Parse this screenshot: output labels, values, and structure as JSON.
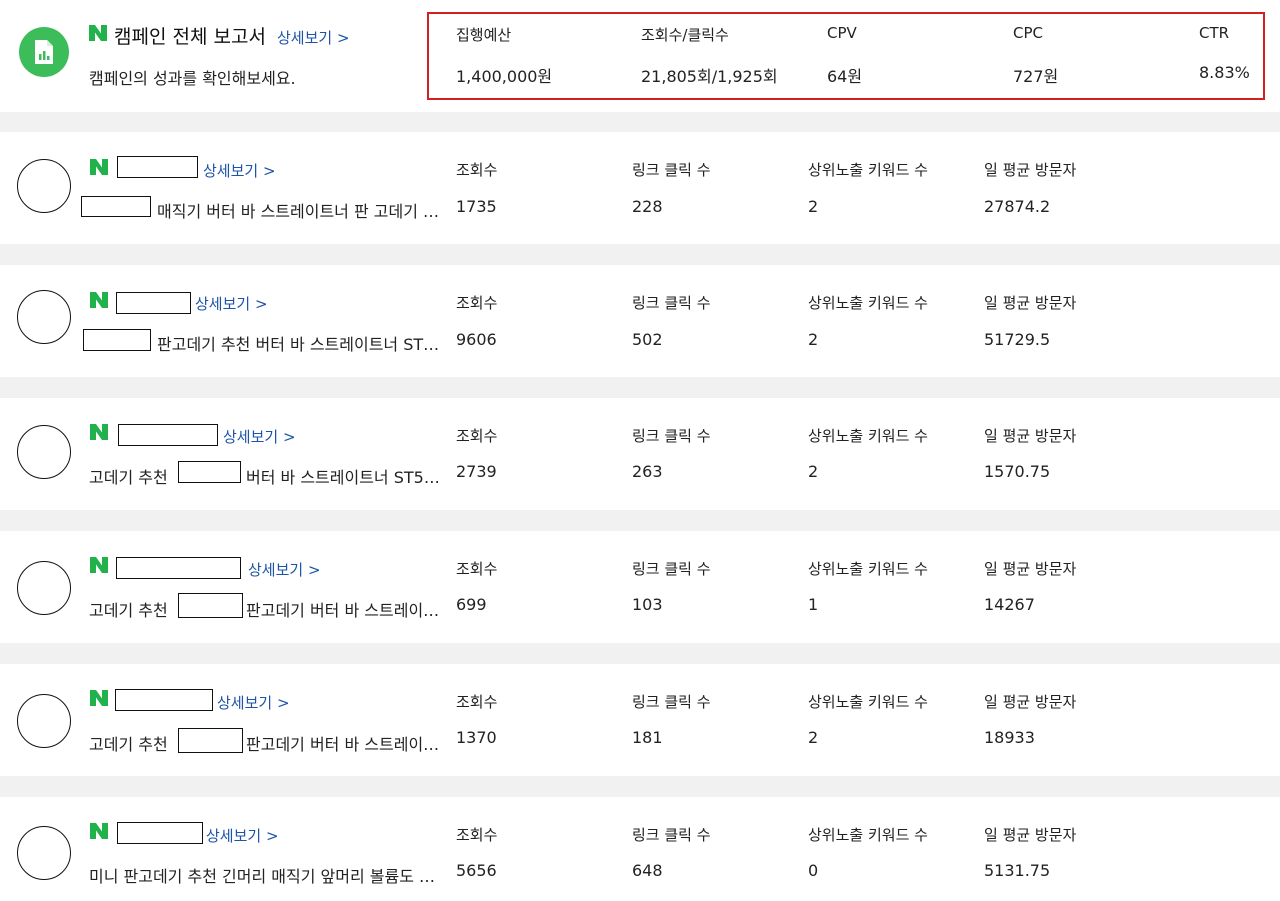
{
  "summary": {
    "title": "캠페인 전체 보고서",
    "detail_link": "상세보기 >",
    "subtitle": "캠페인의 성과를 확인해보세요.",
    "stats": [
      {
        "label": "집행예산",
        "value": "1,400,000원"
      },
      {
        "label": "조회수/클릭수",
        "value": "21,805회/1,925회"
      },
      {
        "label": "CPV",
        "value": "64원"
      },
      {
        "label": "CPC",
        "value": "727원"
      },
      {
        "label": "CTR",
        "value": "8.83%"
      }
    ]
  },
  "column_labels": {
    "views": "조회수",
    "clicks": "링크 클릭 수",
    "keywords": "상위노출 키워드 수",
    "visitors": "일 평균 방문자"
  },
  "detail_link": "상세보기 >",
  "campaigns": [
    {
      "title": "매직기 버터 바 스트레이트너 판 고데기 …",
      "views": "1735",
      "clicks": "228",
      "keywords": "2",
      "visitors": "27874.2"
    },
    {
      "title": "판고데기 추천 버터 바 스트레이트너 ST…",
      "views": "9606",
      "clicks": "502",
      "keywords": "2",
      "visitors": "51729.5"
    },
    {
      "title_a": "고데기 추천",
      "title_b": "버터 바 스트레이트너 ST5…",
      "views": "2739",
      "clicks": "263",
      "keywords": "2",
      "visitors": "1570.75"
    },
    {
      "title_a": "고데기 추천",
      "title_b": "판고데기 버터 바 스트레이…",
      "views": "699",
      "clicks": "103",
      "keywords": "1",
      "visitors": "14267"
    },
    {
      "title_a": "고데기 추천",
      "title_b": "판고데기 버터 바 스트레이…",
      "views": "1370",
      "clicks": "181",
      "keywords": "2",
      "visitors": "18933"
    },
    {
      "title": "미니 판고데기 추천 긴머리 매직기 앞머리 볼륨도 …",
      "views": "5656",
      "clicks": "648",
      "keywords": "0",
      "visitors": "5131.75"
    }
  ]
}
